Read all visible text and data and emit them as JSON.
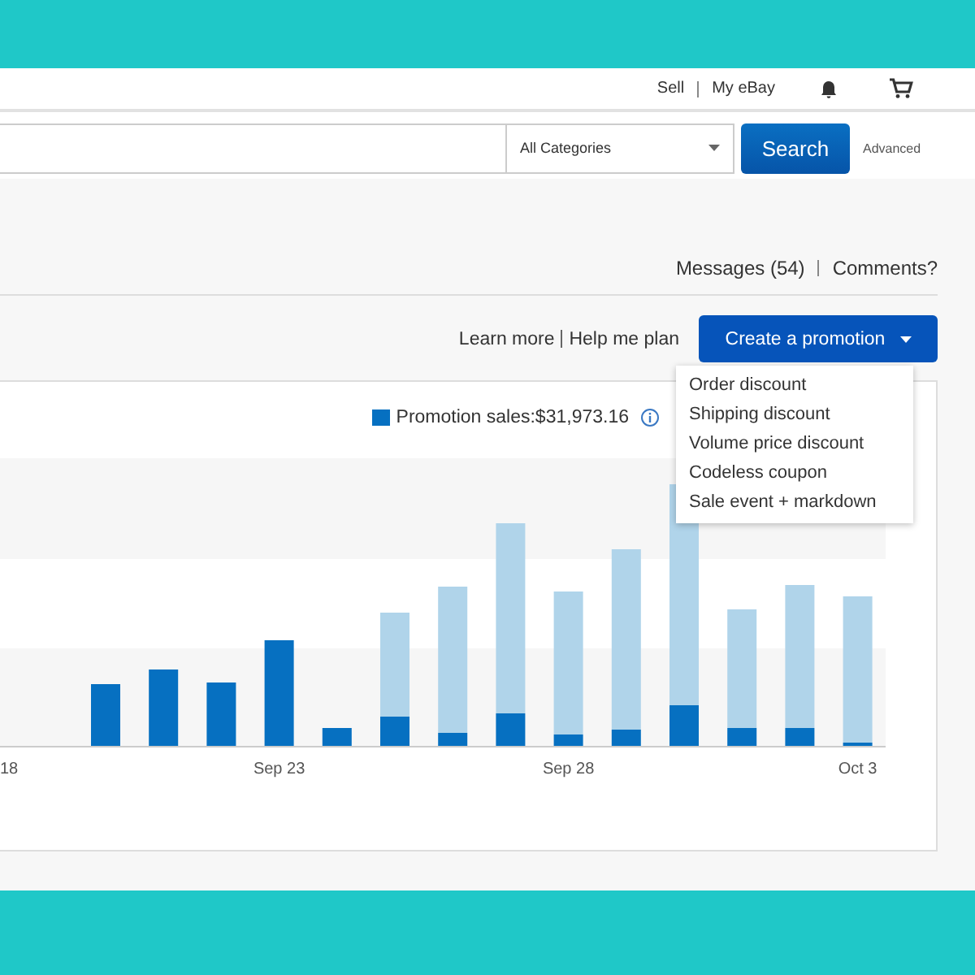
{
  "header": {
    "links": [
      "Sell",
      "My eBay"
    ]
  },
  "search": {
    "category": "All Categories",
    "button": "Search",
    "advanced": "Advanced"
  },
  "top_links": [
    "Messages (54)",
    "Comments?"
  ],
  "help_links": [
    "Learn more",
    "Help me plan"
  ],
  "create_button": {
    "label": "Create a promotion",
    "expanded": true
  },
  "menu": [
    "Order discount",
    "Shipping discount",
    "Volume price discount",
    "Codeless coupon",
    "Sale event + markdown"
  ],
  "chart": {
    "legend": "Promotion sales:$31,973.16",
    "x_labels": [
      "18",
      "Sep 23",
      "Sep 28",
      "Oct 3"
    ]
  }
}
